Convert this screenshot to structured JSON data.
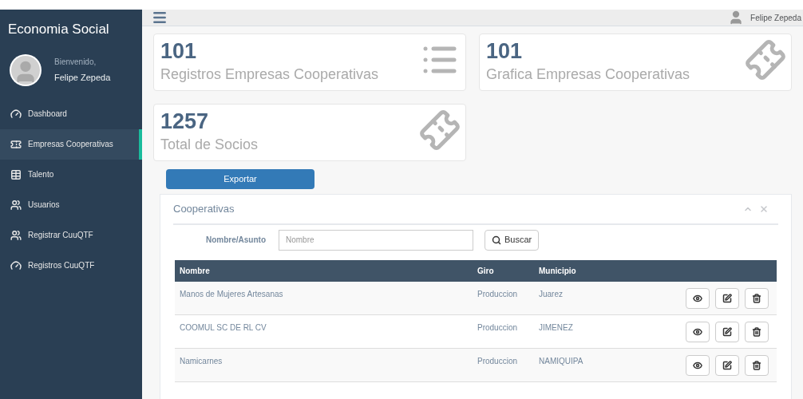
{
  "sidebar": {
    "brand": "Economia Social",
    "welcome": "Bienvenido,",
    "user_name": "Felipe Zepeda",
    "items": [
      {
        "label": "Dashboard",
        "kind": "gauge",
        "selected": false
      },
      {
        "label": "Empresas Cooperativas",
        "kind": "ticket",
        "selected": true
      },
      {
        "label": "Talento",
        "kind": "table",
        "selected": false
      },
      {
        "label": "Usuarios",
        "kind": "users",
        "selected": false
      },
      {
        "label": "Registrar CuuQTF",
        "kind": "users",
        "selected": false
      },
      {
        "label": "Registros CuuQTF",
        "kind": "gauge",
        "selected": false
      }
    ]
  },
  "topbar": {
    "user_name": "Felipe Zepeda"
  },
  "stats": [
    {
      "value": "101",
      "label": "Registros Empresas Cooperativas",
      "kind": "list"
    },
    {
      "value": "101",
      "label": "Grafica Empresas Cooperativas",
      "kind": "ticket"
    },
    {
      "value": "1257",
      "label": "Total de Socios",
      "kind": "ticket"
    }
  ],
  "export_button": "Exportar",
  "panel": {
    "title": "Cooperativas",
    "search_label": "Nombre/Asunto",
    "search_placeholder": "Nombre",
    "search_button": "Buscar",
    "columns": [
      "Nombre",
      "Giro",
      "Municipio"
    ],
    "rows": [
      [
        "Manos de Mujeres Artesanas",
        "Produccion",
        "Juarez"
      ],
      [
        "COOMUL SC DE RL CV",
        "Produccion",
        "JIMENEZ"
      ],
      [
        "Namicarnes",
        "Produccion",
        "NAMIQUIPA"
      ]
    ]
  }
}
